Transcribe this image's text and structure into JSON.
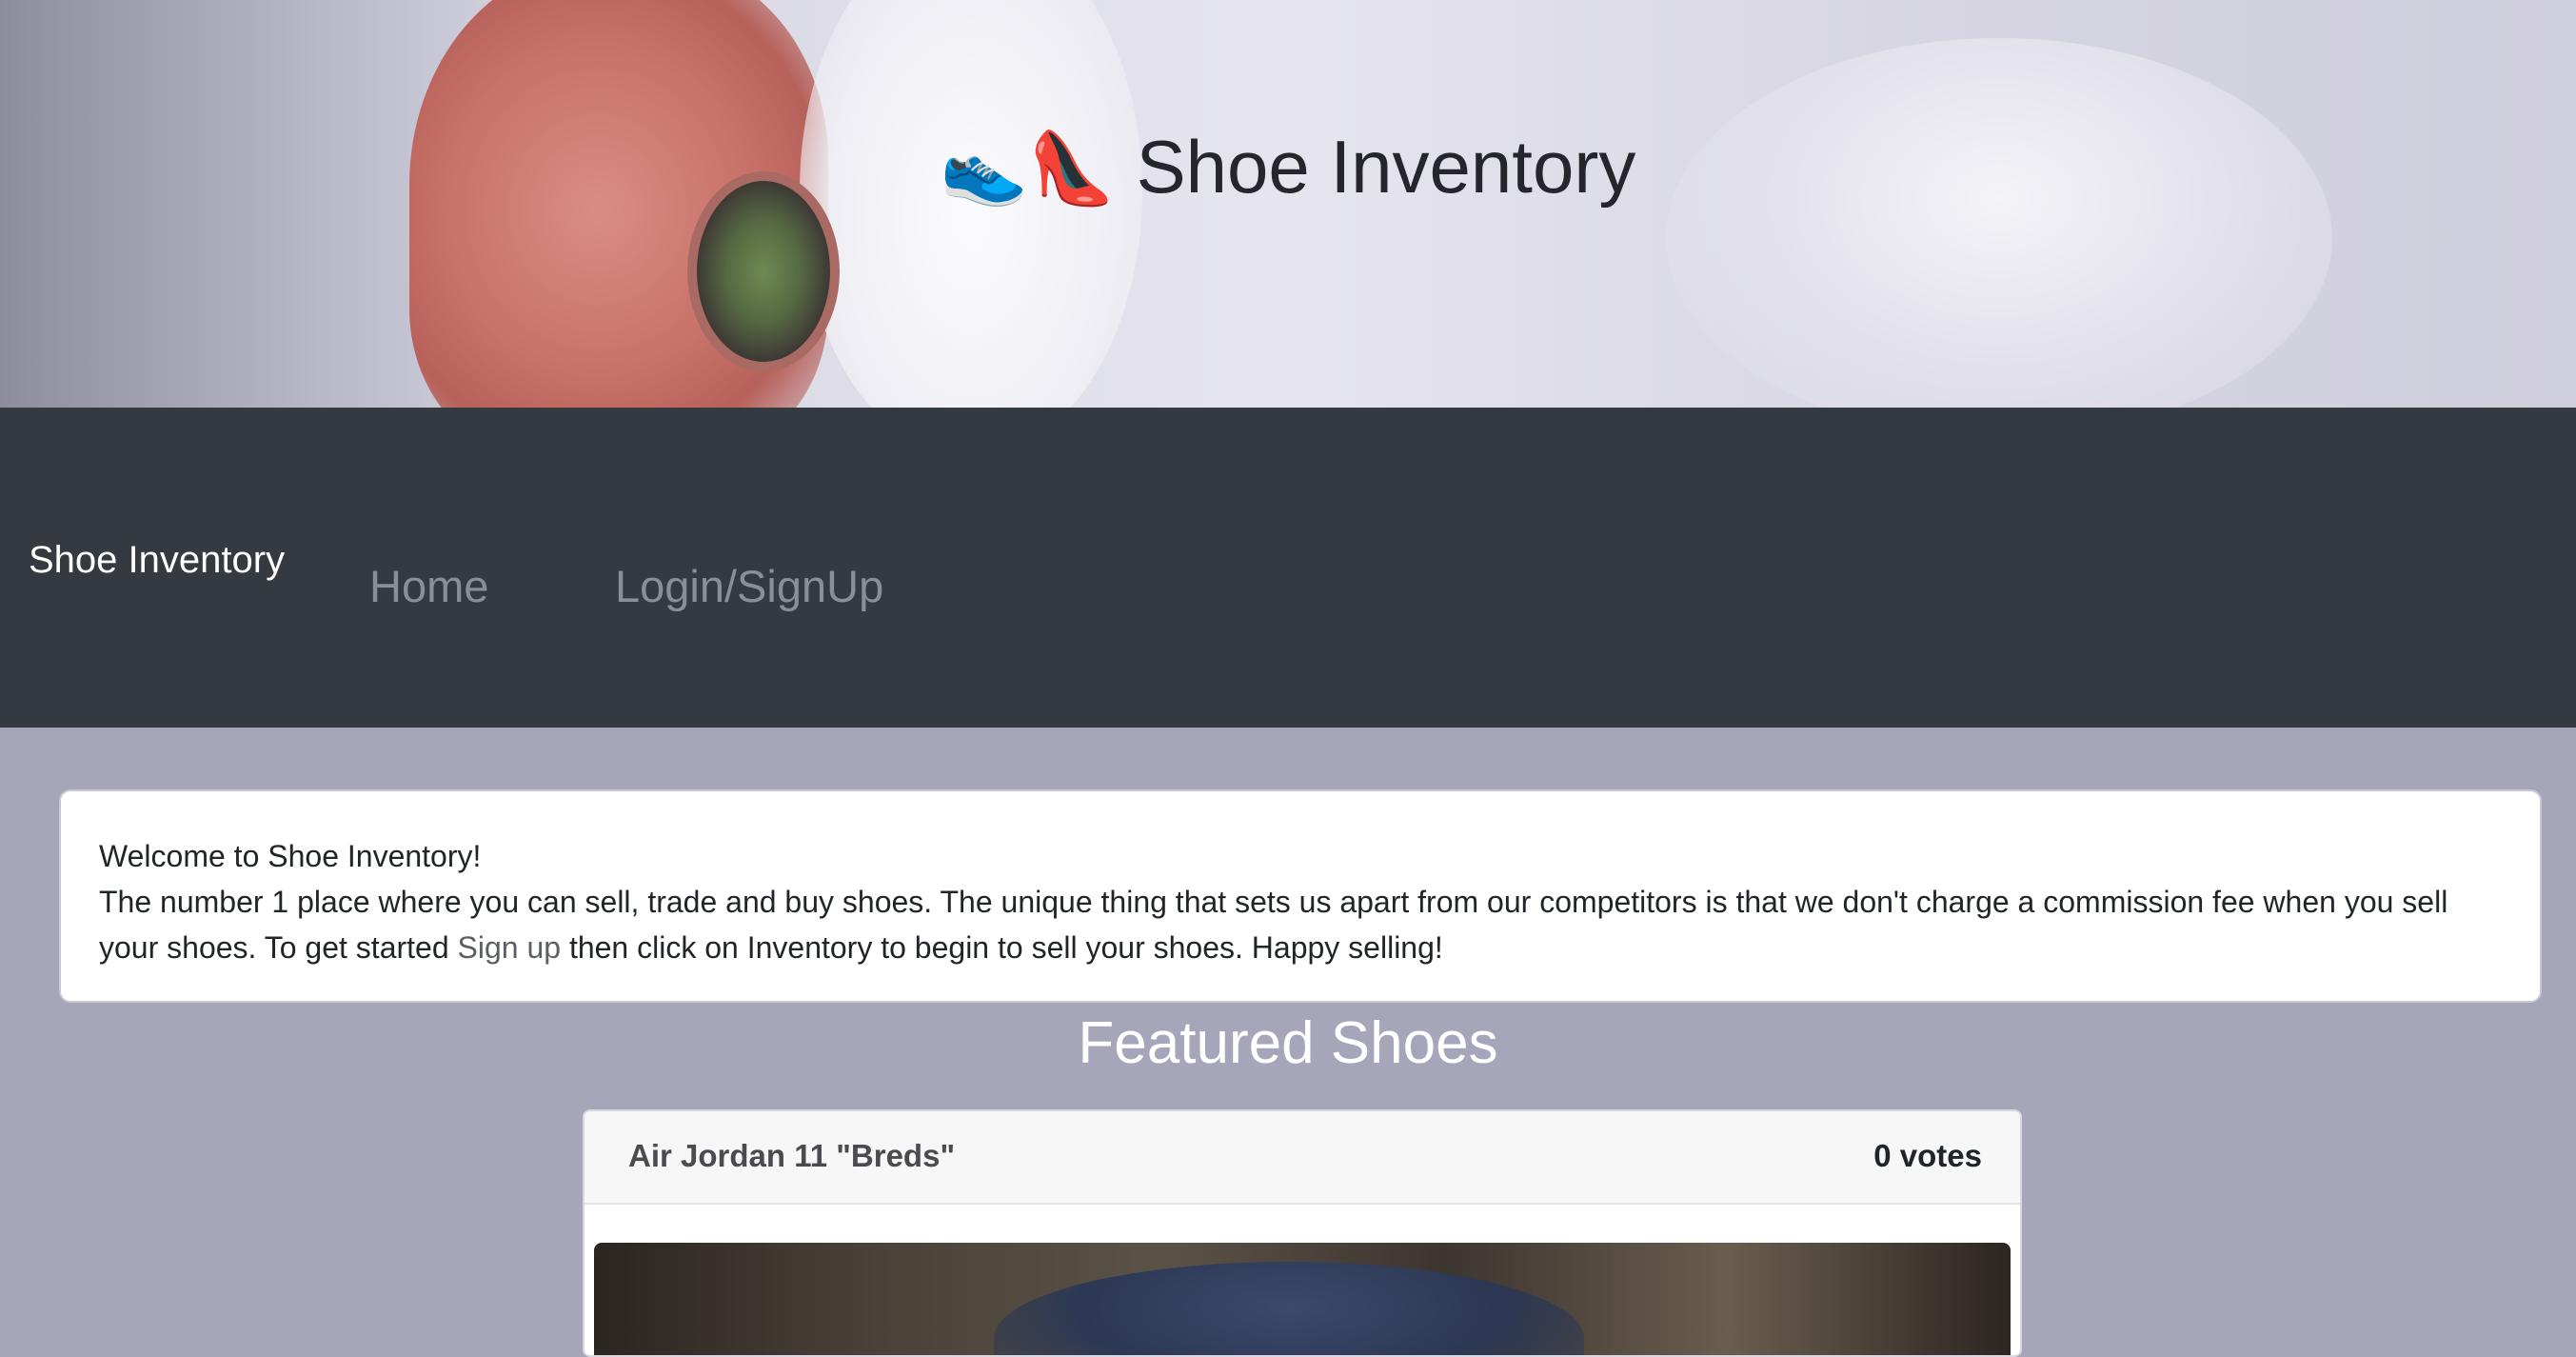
{
  "hero": {
    "emoji": "👟👠",
    "title": "Shoe Inventory"
  },
  "navbar": {
    "brand": "Shoe Inventory",
    "links": [
      {
        "label": "Home"
      },
      {
        "label": "Login/SignUp"
      }
    ]
  },
  "welcome": {
    "heading": "Welcome to Shoe Inventory!",
    "body_before_link": "The number 1 place where you can sell, trade and buy shoes. The unique thing that sets us apart from our competitors is that we don't charge a commission fee when you sell your shoes. To get started ",
    "link_text": "Sign up",
    "body_after_link": " then click on Inventory to begin to sell your shoes. Happy selling!"
  },
  "featured": {
    "title": "Featured Shoes",
    "shoes": [
      {
        "name": "Air Jordan 11 \"Breds\"",
        "votes": "0 votes"
      }
    ]
  },
  "colors": {
    "page_background": "#a6a5b9",
    "navbar_background": "#343a40",
    "nav_link": "#8a8f95"
  }
}
